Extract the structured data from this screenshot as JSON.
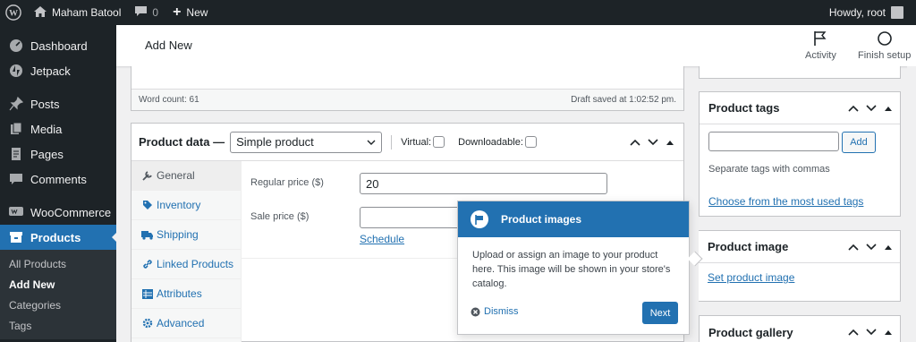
{
  "adminbar": {
    "site_name": "Maham Batool",
    "comments_count": "0",
    "new_label": "New",
    "howdy": "Howdy, root"
  },
  "sidebar": {
    "items": [
      {
        "label": "Dashboard",
        "icon": "dashboard-icon"
      },
      {
        "label": "Jetpack",
        "icon": "jetpack-icon"
      },
      {
        "label": "Posts",
        "icon": "pin-icon"
      },
      {
        "label": "Media",
        "icon": "media-icon"
      },
      {
        "label": "Pages",
        "icon": "pages-icon"
      },
      {
        "label": "Comments",
        "icon": "comments-icon"
      },
      {
        "label": "WooCommerce",
        "icon": "woocommerce-icon"
      },
      {
        "label": "Products",
        "icon": "products-icon"
      }
    ],
    "submenu": [
      "All Products",
      "Add New",
      "Categories",
      "Tags"
    ]
  },
  "header": {
    "title": "Add New",
    "activity_label": "Activity",
    "finish_setup_label": "Finish setup"
  },
  "editor": {
    "word_count": "Word count: 61",
    "draft_saved": "Draft saved at 1:02:52 pm."
  },
  "product_data": {
    "title": "Product data —",
    "type_value": "Simple product",
    "virtual_label": "Virtual:",
    "downloadable_label": "Downloadable:",
    "tabs": [
      {
        "label": "General",
        "icon": "wrench-icon"
      },
      {
        "label": "Inventory",
        "icon": "tag-icon"
      },
      {
        "label": "Shipping",
        "icon": "truck-icon"
      },
      {
        "label": "Linked Products",
        "icon": "link-icon"
      },
      {
        "label": "Attributes",
        "icon": "table-icon"
      },
      {
        "label": "Advanced",
        "icon": "gear-icon"
      }
    ],
    "regular_price_label": "Regular price ($)",
    "regular_price_value": "20",
    "sale_price_label": "Sale price ($)",
    "sale_price_value": "",
    "schedule_link": "Schedule"
  },
  "product_tags": {
    "title": "Product tags",
    "add_label": "Add",
    "hint": "Separate tags with commas",
    "choose_link": "Choose from the most used tags"
  },
  "product_image": {
    "title": "Product image",
    "set_link": "Set product image"
  },
  "product_gallery": {
    "title": "Product gallery"
  },
  "tour": {
    "title": "Product images",
    "body": "Upload or assign an image to your product here. This image will be shown in your store's catalog.",
    "dismiss_label": "Dismiss",
    "next_label": "Next"
  },
  "colors": {
    "accent": "#2271b1",
    "admin_dark": "#1d2327"
  }
}
